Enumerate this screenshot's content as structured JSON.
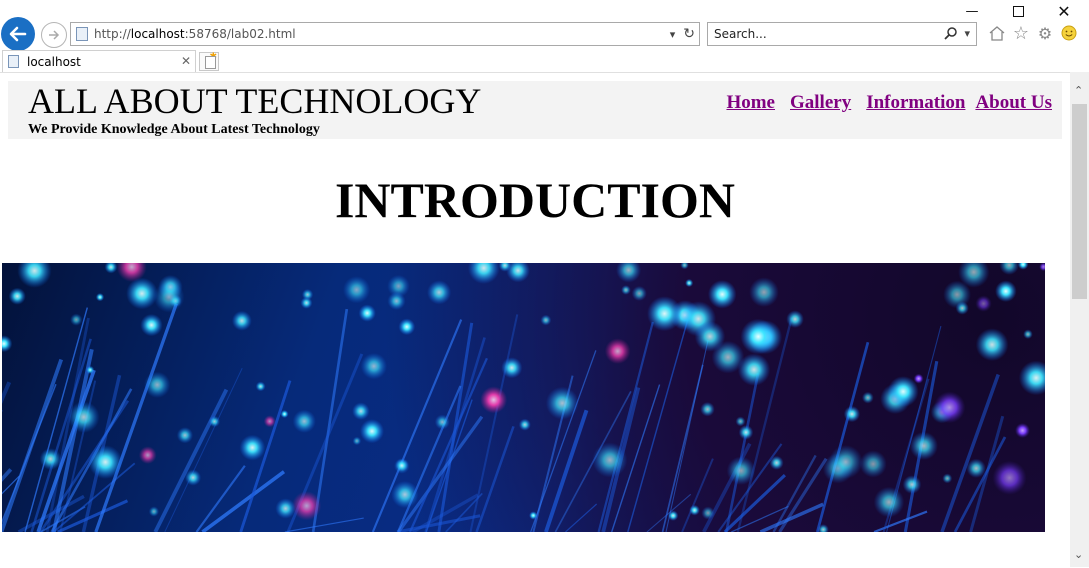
{
  "browser": {
    "url_prefix": "http://",
    "url_host": "localhost",
    "url_rest": ":58768/lab02.html",
    "search_placeholder": "Search...",
    "tab_title": "localhost",
    "icons": [
      "back-arrow-icon",
      "forward-arrow-icon",
      "page-icon",
      "dropdown-icon",
      "refresh-icon",
      "search-icon",
      "home-icon",
      "star-icon",
      "gear-icon",
      "smiley-icon",
      "close-icon",
      "new-tab-icon",
      "minimize-icon",
      "maximize-icon"
    ]
  },
  "site": {
    "title": "ALL ABOUT TECHNOLOGY",
    "tagline": "We Provide Knowledge About Latest Technology",
    "nav": [
      {
        "label": "Home"
      },
      {
        "label": "Gallery"
      },
      {
        "label": "Information"
      },
      {
        "label": "About Us"
      }
    ],
    "link_color": "#800080"
  },
  "main": {
    "heading": "INTRODUCTION",
    "hero_image": "fiber-optic-lights"
  }
}
